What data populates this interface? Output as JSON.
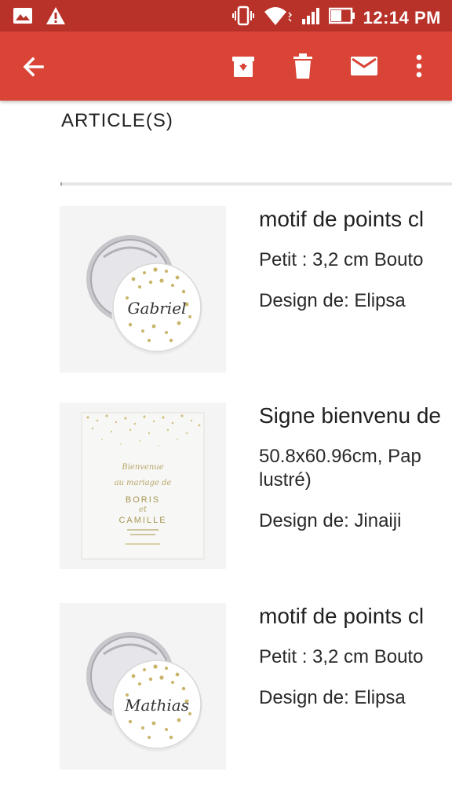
{
  "status_bar": {
    "time": "12:14 PM",
    "icons": [
      "gallery-icon",
      "warning-icon",
      "vibrate-icon",
      "wifi-icon",
      "signal-icon",
      "battery-icon"
    ]
  },
  "app_bar": {
    "actions": [
      "back-arrow-icon",
      "archive-icon",
      "delete-icon",
      "mail-icon",
      "more-vert-icon"
    ]
  },
  "section": {
    "title": "ARTICLE(S)"
  },
  "items": [
    {
      "title": "motif de points cl",
      "size": "Petit : 3,2 cm Bouto",
      "designer": "Design de: Elipsa",
      "button_name": "Gabriel"
    },
    {
      "title": "Signe bienvenu de",
      "size": "50.8x60.96cm, Pap lustré)",
      "designer": "Design de: Jinaiji",
      "sign_lines": [
        "Bienvenue",
        "au mariage de",
        "BORIS",
        "et",
        "CAMILLE"
      ]
    },
    {
      "title": "motif de points cl",
      "size": "Petit : 3,2 cm Bouto",
      "designer": "Design de: Elipsa",
      "button_name": "Mathias"
    }
  ],
  "colors": {
    "status_bar": "#b8322a",
    "app_bar": "#d94437",
    "confetti_gold": "#c9b56a"
  }
}
